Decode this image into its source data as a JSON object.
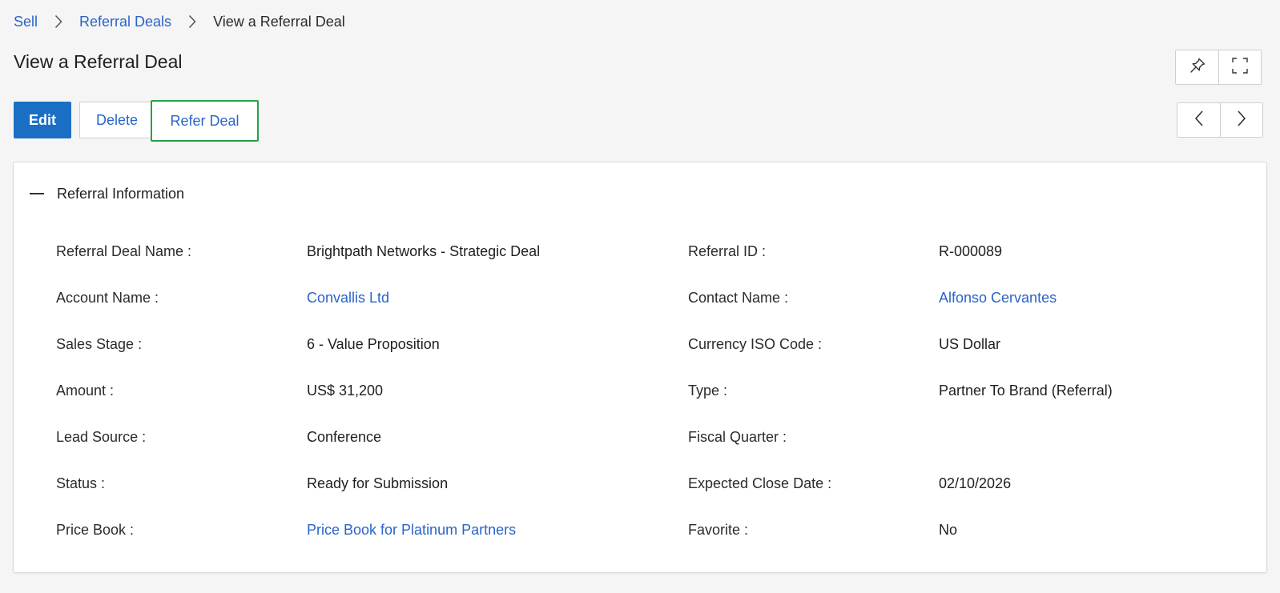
{
  "breadcrumb": {
    "items": [
      "Sell",
      "Referral Deals",
      "View a Referral Deal"
    ]
  },
  "page": {
    "title": "View a Referral Deal"
  },
  "toolbar": {
    "edit_label": "Edit",
    "delete_label": "Delete",
    "refer_label": "Refer Deal",
    "pin_icon": "pin-icon",
    "fullscreen_icon": "expand-icon",
    "prev_icon": "chevron-left-icon",
    "next_icon": "chevron-right-icon"
  },
  "section": {
    "title": "Referral Information",
    "collapse_icon": "minus-icon"
  },
  "fields": {
    "referral_deal_name": {
      "label": "Referral Deal Name :",
      "value": "Brightpath Networks - Strategic Deal"
    },
    "account_name": {
      "label": "Account Name :",
      "value": "Convallis Ltd"
    },
    "sales_stage": {
      "label": "Sales Stage :",
      "value": "6 - Value Proposition"
    },
    "amount": {
      "label": "Amount :",
      "value": "US$ 31,200"
    },
    "lead_source": {
      "label": "Lead Source :",
      "value": "Conference"
    },
    "status": {
      "label": "Status :",
      "value": "Ready for Submission"
    },
    "price_book": {
      "label": "Price Book :",
      "value": "Price Book for Platinum Partners"
    },
    "referral_id": {
      "label": "Referral ID :",
      "value": "R-000089"
    },
    "contact_name": {
      "label": "Contact Name :",
      "value": "Alfonso Cervantes"
    },
    "currency": {
      "label": "Currency ISO Code :",
      "value": "US Dollar"
    },
    "type": {
      "label": "Type :",
      "value": "Partner To Brand (Referral)"
    },
    "fiscal_quarter": {
      "label": "Fiscal Quarter :",
      "value": ""
    },
    "expected_close_date": {
      "label": "Expected Close Date :",
      "value": "02/10/2026"
    },
    "favorite": {
      "label": "Favorite :",
      "value": "No"
    }
  },
  "colors": {
    "link": "#2a64c9",
    "primary_button": "#1a6fc4",
    "focus_outline": "#24a245"
  }
}
